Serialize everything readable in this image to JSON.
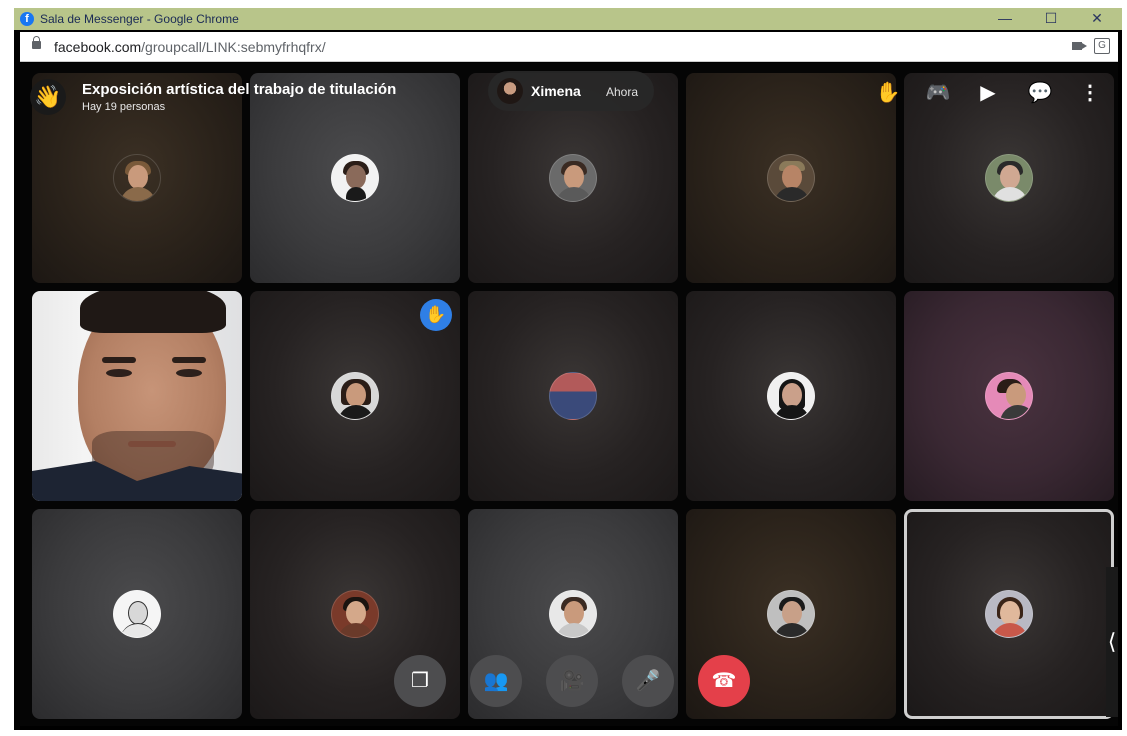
{
  "window": {
    "title": "Sala de Messenger - Google Chrome",
    "minimize": "—",
    "maximize": "☐",
    "close": "✕"
  },
  "address_bar": {
    "domain": "facebook.com",
    "path": "/groupcall/LINK:sebmyfrhqfrx/"
  },
  "call": {
    "title": "Exposición artística del trabajo de titulación",
    "participant_count": "Hay 19 personas",
    "wave_icon": "waving-hand-icon",
    "notification": {
      "name": "Ximena",
      "time": "Ahora"
    },
    "top_actions": [
      {
        "name": "raise-hand-icon",
        "glyph": "✋"
      },
      {
        "name": "games-icon",
        "glyph": "🎮"
      },
      {
        "name": "present-screen-icon",
        "glyph": "▶"
      },
      {
        "name": "chat-icon",
        "glyph": "💬"
      },
      {
        "name": "more-icon",
        "glyph": "⋮"
      }
    ],
    "controls": [
      {
        "name": "switch-view-button",
        "glyph": "❐"
      },
      {
        "name": "participants-button",
        "glyph": "👥"
      },
      {
        "name": "camera-button",
        "glyph": "🎥"
      },
      {
        "name": "microphone-button",
        "glyph": "🎤"
      },
      {
        "name": "end-call-button",
        "glyph": "☎"
      }
    ],
    "side_handle": "⟨",
    "raised_hand_badge": "✋"
  },
  "colors": {
    "titlebar": "#b8c58a",
    "call_background": "#050505",
    "end_call": "#e4404a",
    "raise_hand_badge": "#2f7fe6"
  }
}
